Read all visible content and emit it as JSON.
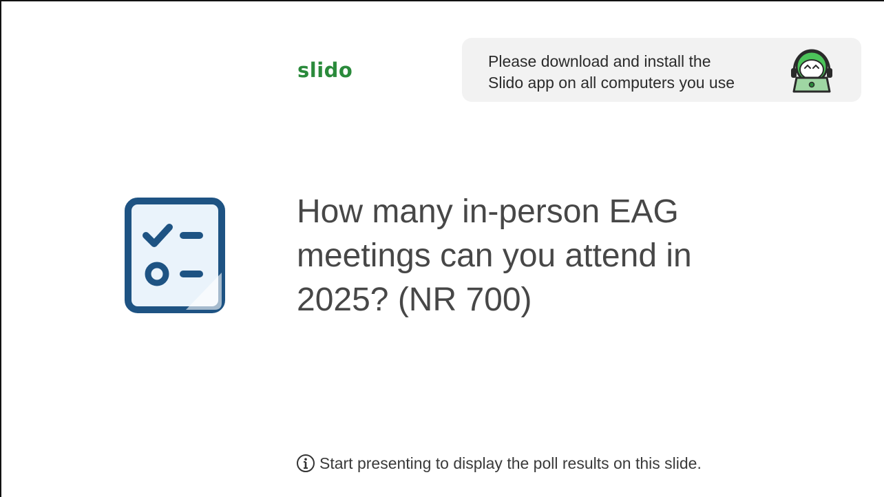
{
  "brand": {
    "logo_text": "slido",
    "logo_color": "#2a8a3b"
  },
  "banner": {
    "line1": "Please download and install the",
    "line2": "Slido app on all computers you use",
    "mascot_icon": "slido-mascot-laptop-icon"
  },
  "poll": {
    "icon": "poll-checklist-icon",
    "icon_color": "#1e5383",
    "question_lines": [
      "How many in-person EAG",
      "meetings can you attend in",
      "2025? (NR 700)"
    ]
  },
  "footer": {
    "icon": "info-icon",
    "text": "Start presenting to display the poll results on this slide."
  }
}
